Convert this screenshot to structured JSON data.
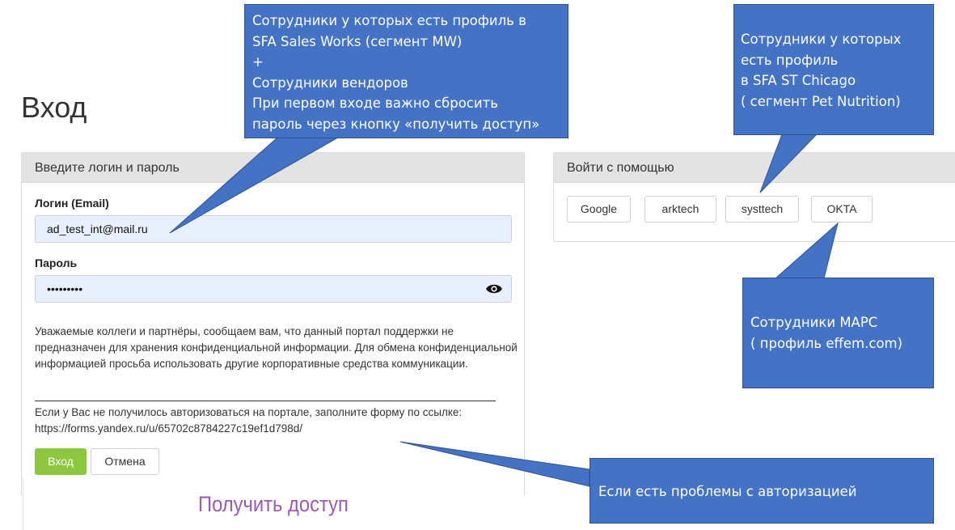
{
  "page": {
    "title": "Вход"
  },
  "login": {
    "header": "Введите логин и пароль",
    "email_label": "Логин (Email)",
    "email_value": "ad_test_int@mail.ru",
    "password_label": "Пароль",
    "password_value": "•••••••••",
    "notice": "Уважаемые коллеги и партнёры, сообщаем вам, что данный портал поддержки не предназначен для хранения конфиденциальной информации. Для обмена конфиденциальной информацией просьба использовать другие корпоративные средства коммуникации.",
    "help_text": "Если у Вас не получилось авторизоваться на портале, заполните форму по ссылке: https://forms.yandex.ru/u/65702c8784227c19ef1d798d/",
    "login_button": "Вход",
    "cancel_button": "Отмена",
    "get_access": "Получить доступ"
  },
  "sso": {
    "header": "Войти с помощью",
    "providers": [
      "Google",
      "arktech",
      "systtech",
      "OKTA"
    ]
  },
  "callouts": {
    "sfa_mw": {
      "lines": [
        "Сотрудники у которых есть профиль в",
        "SFA Sales Works  (сегмент MW)",
        "+",
        "Сотрудники вендоров",
        "При первом входе важно сбросить",
        "пароль через кнопку «получить доступ»"
      ]
    },
    "sfa_st": {
      "lines": [
        "Сотрудники у которых",
        "есть профиль",
        "в SFA ST Chicago",
        "( сегмент Pet Nutrition)"
      ]
    },
    "mars": {
      "lines": [
        "Сотрудники МАРС",
        "( профиль effem.com)"
      ]
    },
    "auth_problem": {
      "text": "Если есть проблемы с авторизацией"
    }
  },
  "colors": {
    "callout_fill": "#4472c4",
    "login_button": "#8dc63f",
    "get_access_link": "#9b59b6",
    "input_bg": "#e8f0fe"
  }
}
